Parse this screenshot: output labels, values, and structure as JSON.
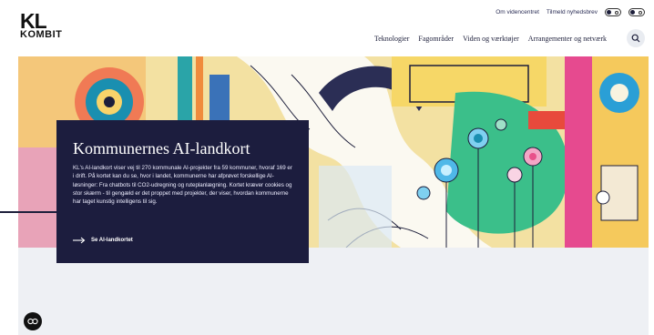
{
  "brand": {
    "line1": "KL",
    "line2": "KOMBIT"
  },
  "utility": {
    "link1": "Om videncentret",
    "link2": "Tilmeld nyhedsbrev"
  },
  "nav": {
    "items": [
      "Teknologier",
      "Fagområder",
      "Viden og værktøjer",
      "Arrangementer og netværk"
    ]
  },
  "hero": {
    "title": "Kommunernes AI-landkort",
    "body": "KL's AI-landkort viser vej til 270 kommunale AI-projekter fra 59 kommuner, hvoraf 169 er i drift. På kortet kan du se, hvor i landet, kommunerne har afprøvet forskellige AI-løsninger: Fra chatbots til CO2-udregning og ruteplanlægning. Kortet kræver cookies og stor skærm - til gengæld er det proppet med projekter, der viser, hvordan kommunerne har taget kunstig intelligens til sig.",
    "cta": "Se AI-landkortet"
  },
  "icons": {
    "search": "search-icon",
    "cookie": "cookie-icon",
    "arrow": "arrow-right-icon"
  },
  "colors": {
    "navy": "#1c1d3e",
    "grey": "#eef0f4"
  }
}
